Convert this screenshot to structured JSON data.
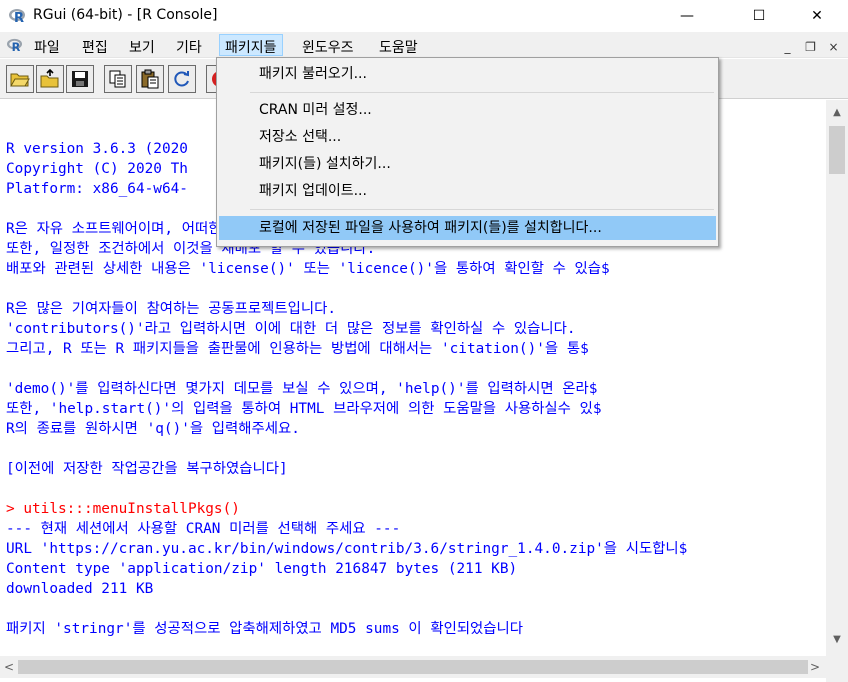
{
  "window": {
    "title": "RGui (64-bit) - [R Console]",
    "min_glyph": "—",
    "max_glyph": "☐",
    "close_glyph": "✕"
  },
  "menubar": {
    "items": [
      "파일",
      "편집",
      "보기",
      "기타",
      "패키지들",
      "윈도우즈",
      "도움말"
    ],
    "active_index": 4,
    "mdi_min": "_",
    "mdi_restore": "❐",
    "mdi_close": "×"
  },
  "toolbar": {
    "buttons": [
      "open-script-icon",
      "load-workspace-icon",
      "save-icon",
      "copy-icon",
      "paste-icon",
      "refresh-icon",
      "stop-icon"
    ]
  },
  "dropdown": {
    "items": [
      "패키지 불러오기...",
      "CRAN 미러 설정...",
      "저장소 선택...",
      "패키지(들) 설치하기...",
      "패키지 업데이트...",
      "로컬에 저장된 파일을 사용하여 패키지(들)를 설치합니다..."
    ],
    "highlighted_index": 5
  },
  "console": {
    "lines": [
      "R version 3.6.3 (2020",
      "Copyright (C) 2020 Th",
      "Platform: x86_64-w64-",
      "",
      "R은 자유 소프트웨어이며, 어떠한",
      "또한, 일정한 조건하에서 이것을 재배포 할 수 있습니다.",
      "배포와 관련된 상세한 내용은 'license()' 또는 'licence()'을 통하여 확인할 수 있습$",
      "",
      "R은 많은 기여자들이 참여하는 공동프로젝트입니다.",
      "'contributors()'라고 입력하시면 이에 대한 더 많은 정보를 확인하실 수 있습니다.",
      "그리고, R 또는 R 패키지들을 출판물에 인용하는 방법에 대해서는 'citation()'을 통$",
      "",
      "'demo()'를 입력하신다면 몇가지 데모를 보실 수 있으며, 'help()'를 입력하시면 온라$",
      "또한, 'help.start()'의 입력을 통하여 HTML 브라우저에 의한 도움말을 사용하실수 있$",
      "R의 종료를 원하시면 'q()'을 입력해주세요.",
      "",
      "[이전에 저장한 작업공간을 복구하였습니다]",
      "",
      "> utils:::menuInstallPkgs()",
      "--- 현재 세션에서 사용할 CRAN 미러를 선택해 주세요 ---",
      "URL 'https://cran.yu.ac.kr/bin/windows/contrib/3.6/stringr_1.4.0.zip'을 시도합니$",
      "Content type 'application/zip' length 216847 bytes (211 KB)",
      "downloaded 211 KB",
      "",
      "패키지 'stringr'를 성공적으로 압축해제하였고 MD5 sums 이 확인되었습니다"
    ],
    "command_line_index": 18
  },
  "scroll": {
    "up": "▲",
    "down": "▼",
    "left": "<",
    "right": ">"
  },
  "colors": {
    "output_text": "#0000ff",
    "command_text": "#ff0000",
    "menu_highlight": "#91c9f7",
    "active_menu": "#cce8ff"
  }
}
